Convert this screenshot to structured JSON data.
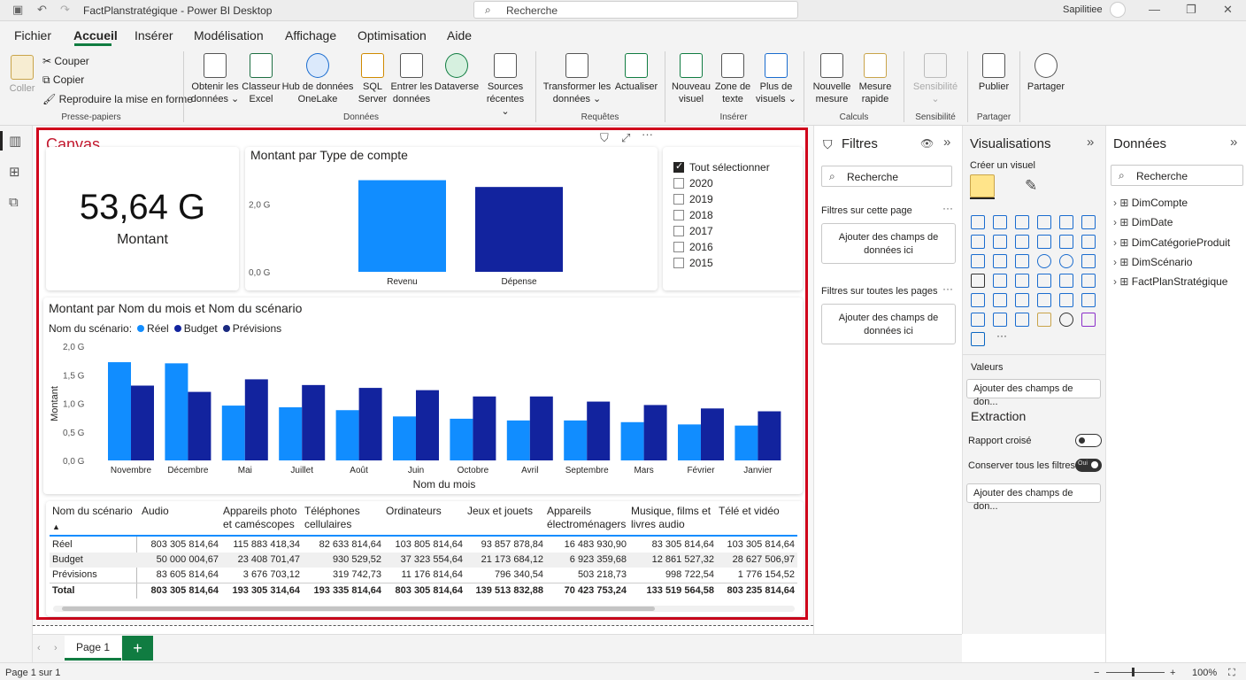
{
  "window": {
    "title": "FactPlanstratégique - Power BI Desktop",
    "search": "Recherche",
    "user": "Sapilitiee"
  },
  "menu": [
    "Fichier",
    "Accueil",
    "Insérer",
    "Modélisation",
    "Affichage",
    "Optimisation",
    "Aide"
  ],
  "ribbon": {
    "clipboard": {
      "paste": "Coller",
      "cut": "Couper",
      "copy": "Copier",
      "format_painter": "Reproduire la mise en forme",
      "group": "Presse-papiers"
    },
    "data": {
      "get_data": "Obtenir les données ⌄",
      "excel": "Classeur Excel",
      "onelake": "Hub de données OneLake",
      "sql": "SQL Server",
      "enter": "Entrer les données",
      "dataverse": "Dataverse",
      "recent": "Sources récentes ⌄",
      "group": "Données"
    },
    "queries": {
      "transform": "Transformer les données ⌄",
      "refresh": "Actualiser",
      "group": "Requêtes"
    },
    "insert": {
      "new_visual": "Nouveau visuel",
      "text_box": "Zone de texte",
      "more_visuals": "Plus de visuels ⌄",
      "group": "Insérer"
    },
    "calc": {
      "new_measure": "Nouvelle mesure",
      "quick_measure": "Mesure rapide",
      "group": "Calculs"
    },
    "sensitivity": {
      "label": "Sensibilité ⌄",
      "group": "Sensibilité"
    },
    "share": {
      "publish": "Publier",
      "share": "Partager",
      "group": "Partager"
    }
  },
  "canvas": {
    "label": "Canvas",
    "kpi": {
      "value": "53,64 G",
      "label": "Montant"
    },
    "bar_chart": {
      "title": "Montant par Type de compte",
      "ticks": [
        "2,0 G",
        "0,0 G"
      ]
    },
    "column_chart": {
      "title": "Montant par Nom du mois et Nom du scénario",
      "legend_title": "Nom du scénario:",
      "xlabel": "Nom du mois",
      "ylabel": "Montant",
      "ticks": [
        "2,0 G",
        "1,5 G",
        "1,0 G",
        "0,5 G",
        "0,0 G"
      ]
    },
    "slicer": {
      "select_all": "Tout sélectionner",
      "years": [
        "2020",
        "2019",
        "2018",
        "2017",
        "2016",
        "2015"
      ]
    },
    "table": {
      "headers": [
        "Nom du scénario",
        "Audio",
        "Appareils photo et caméscopes",
        "Téléphones cellulaires",
        "Ordinateurs",
        "Jeux et jouets",
        "Appareils électroménagers",
        "Musique, films et livres audio",
        "Télé et vidéo"
      ],
      "rows": [
        [
          "Réel",
          "803 305 814,64",
          "115 883 418,34",
          "82 633 814,64",
          "103 805 814,64",
          "93 857 878,84",
          "16 483 930,90",
          "83 305 814,64",
          "103 305 814,64"
        ],
        [
          "Budget",
          "50 000 004,67",
          "23 408 701,47",
          "930 529,52",
          "37 323 554,64",
          "21 173 684,12",
          "6 923 359,68",
          "12 861 527,32",
          "28 627 506,97"
        ],
        [
          "Prévisions",
          "83 605 814,64",
          "3 676 703,12",
          "319 742,73",
          "11 176 814,64",
          "796 340,54",
          "503 218,73",
          "998 722,54",
          "1 776 154,52"
        ],
        [
          "Total",
          "803 305 814,64",
          "193 305 314,64",
          "193 335 814,64",
          "803 305 814,64",
          "139 513 832,88",
          "70 423 753,24",
          "133 519 564,58",
          "803 235 814,64"
        ]
      ]
    }
  },
  "chart_data": [
    {
      "type": "bar",
      "categories": [
        "Revenu",
        "Dépense"
      ],
      "values": [
        2.7,
        2.5
      ],
      "title": "Montant par Type de compte",
      "ylim": [
        0,
        3.0
      ],
      "colors": [
        "#118dff",
        "#12239e"
      ]
    },
    {
      "type": "bar",
      "title": "Montant par Nom du mois et Nom du scénario",
      "xlabel": "Nom du mois",
      "ylabel": "Montant",
      "ylim": [
        0,
        2.0
      ],
      "legend": "top-left",
      "categories": [
        "Novembre",
        "Décembre",
        "Mai",
        "Juillet",
        "Août",
        "Juin",
        "Octobre",
        "Avril",
        "Septembre",
        "Mars",
        "Février",
        "Janvier"
      ],
      "series": [
        {
          "name": "Réel",
          "color": "#118dff",
          "values": [
            1.72,
            1.7,
            0.96,
            0.93,
            0.88,
            0.77,
            0.73,
            0.7,
            0.7,
            0.67,
            0.63,
            0.61
          ]
        },
        {
          "name": "Budget",
          "color": "#12239e",
          "values": [
            1.31,
            1.2,
            1.42,
            1.32,
            1.27,
            1.23,
            1.12,
            1.12,
            1.03,
            0.97,
            0.91,
            0.86
          ]
        },
        {
          "name": "Prévisions",
          "color": "#1a2a80",
          "values": []
        }
      ]
    }
  ],
  "filters": {
    "title": "Filtres",
    "search": "Recherche",
    "page_section": "Filtres sur cette page",
    "all_section": "Filtres sur toutes les pages",
    "drop": "Ajouter des champs de données ici"
  },
  "visualizations": {
    "title": "Visualisations",
    "create": "Créer un visuel",
    "values": "Valeurs",
    "values_drop": "Ajouter des champs de don...",
    "extraction": "Extraction",
    "cross_report": "Rapport croisé",
    "keep_filters": "Conserver tous les filtres",
    "toggle_on": "Oui",
    "extraction_drop": "Ajouter des champs de don..."
  },
  "data_pane": {
    "title": "Données",
    "search": "Recherche",
    "tables": [
      "DimCompte",
      "DimDate",
      "DimCatégorieProduit",
      "DimScénario",
      "FactPlanStratégique"
    ]
  },
  "pages": {
    "tab": "Page 1",
    "add": "+"
  },
  "status": {
    "page": "Page 1 sur 1",
    "zoom": "100%"
  }
}
